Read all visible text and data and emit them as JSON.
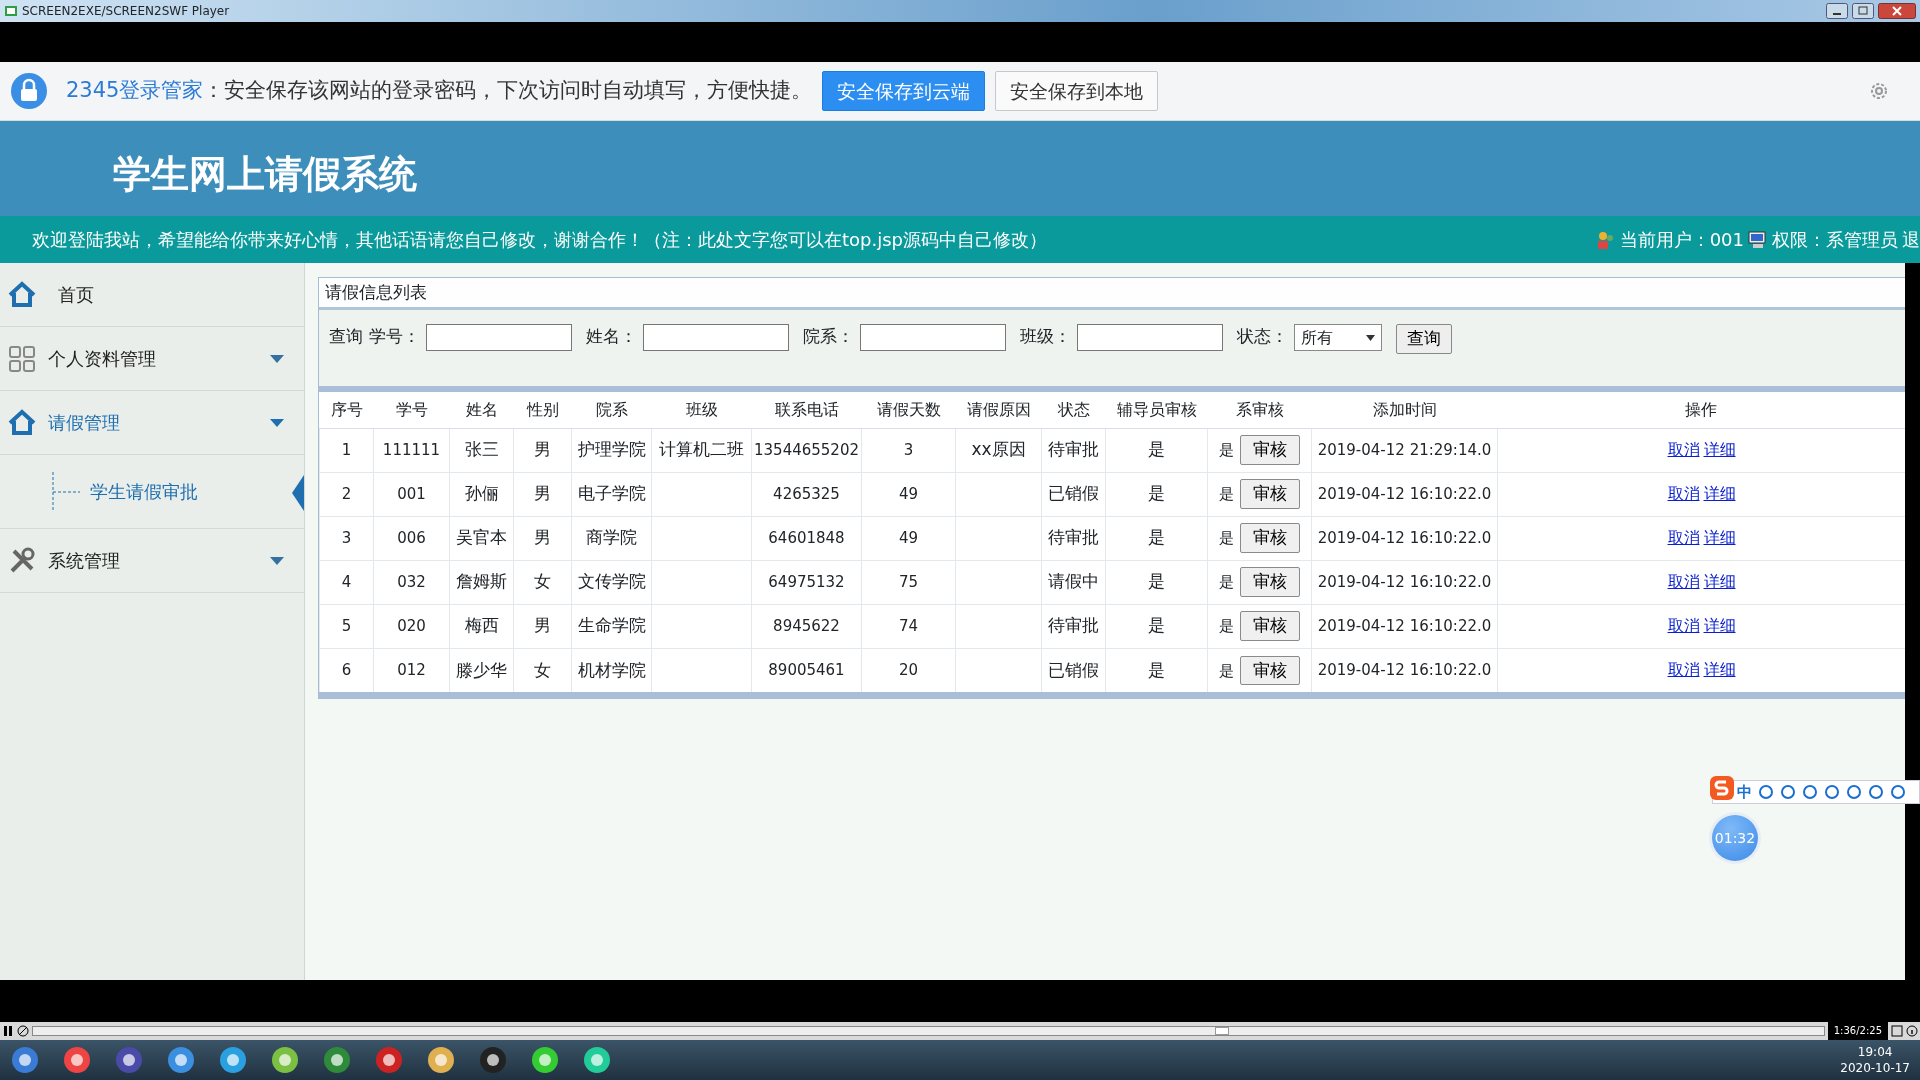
{
  "player": {
    "title": "SCREEN2EXE/SCREEN2SWF Player",
    "time": "1:36/2:25",
    "level": 0.66
  },
  "password_bar": {
    "brand": "2345登录管家",
    "message": "：安全保存该网站的登录密码，下次访问时自动填写，方便快捷。",
    "buttons": [
      {
        "label": "安全保存到云端",
        "kind": "primary"
      },
      {
        "label": "安全保存到本地",
        "kind": "secondary"
      }
    ]
  },
  "header": {
    "title": "学生网上请假系统",
    "welcome": "欢迎登陆我站，希望能给你带来好心情，其他话语请您自己修改，谢谢合作！（注：此处文字您可以在top.jsp源码中自己修改）",
    "user": "当前用户：001",
    "role": "权限：系管理员",
    "logout": "退"
  },
  "sidebar": {
    "items": [
      {
        "label": "首页"
      },
      {
        "label": "个人资料管理",
        "expanded": false
      },
      {
        "label": "请假管理",
        "expanded": true,
        "children": [
          {
            "label": "学生请假审批",
            "selected": true
          }
        ]
      },
      {
        "label": "系统管理",
        "expanded": false
      }
    ]
  },
  "panel": {
    "title": "请假信息列表",
    "search": {
      "lead": "查询",
      "fields": [
        {
          "label": "学号："
        },
        {
          "label": "姓名："
        },
        {
          "label": "院系："
        },
        {
          "label": "班级："
        }
      ],
      "status_label": "状态：",
      "status_value": "所有",
      "button": "查询"
    },
    "table": {
      "columns": [
        "序号",
        "学号",
        "姓名",
        "性别",
        "院系",
        "班级",
        "联系电话",
        "请假天数",
        "请假原因",
        "状态",
        "辅导员审核",
        "系审核",
        "添加时间",
        "操作"
      ],
      "rows": [
        {
          "cells": [
            "1",
            "111111",
            "张三",
            "男",
            "护理学院",
            "计算机二班",
            "13544655202",
            "3",
            "xx原因",
            "待审批",
            "是",
            "是"
          ],
          "review": "审核",
          "added": "2019-04-12 21:29:14.0",
          "actions": [
            "取消",
            "详细"
          ]
        },
        {
          "cells": [
            "2",
            "001",
            "孙俪",
            "男",
            "电子学院",
            "",
            "4265325",
            "49",
            "",
            "已销假",
            "是",
            "是"
          ],
          "review": "审核",
          "added": "2019-04-12 16:10:22.0",
          "actions": [
            "取消",
            "详细"
          ]
        },
        {
          "cells": [
            "3",
            "006",
            "吴官本",
            "男",
            "商学院",
            "",
            "64601848",
            "49",
            "",
            "待审批",
            "是",
            "是"
          ],
          "review": "审核",
          "added": "2019-04-12 16:10:22.0",
          "actions": [
            "取消",
            "详细"
          ]
        },
        {
          "cells": [
            "4",
            "032",
            "詹姆斯",
            "女",
            "文传学院",
            "",
            "64975132",
            "75",
            "",
            "请假中",
            "是",
            "是"
          ],
          "review": "审核",
          "added": "2019-04-12 16:10:22.0",
          "actions": [
            "取消",
            "详细"
          ]
        },
        {
          "cells": [
            "5",
            "020",
            "梅西",
            "男",
            "生命学院",
            "",
            "8945622",
            "74",
            "",
            "待审批",
            "是",
            "是"
          ],
          "review": "审核",
          "added": "2019-04-12 16:10:22.0",
          "actions": [
            "取消",
            "详细"
          ]
        },
        {
          "cells": [
            "6",
            "012",
            "滕少华",
            "女",
            "机材学院",
            "",
            "89005461",
            "20",
            "",
            "已销假",
            "是",
            "是"
          ],
          "review": "审核",
          "added": "2019-04-12 16:10:22.0",
          "actions": [
            "取消",
            "详细"
          ]
        }
      ]
    }
  },
  "ime": {
    "mode": "中"
  },
  "timer": "01:32",
  "taskbar": {
    "time": "19:04",
    "date": "2020-10-17"
  }
}
